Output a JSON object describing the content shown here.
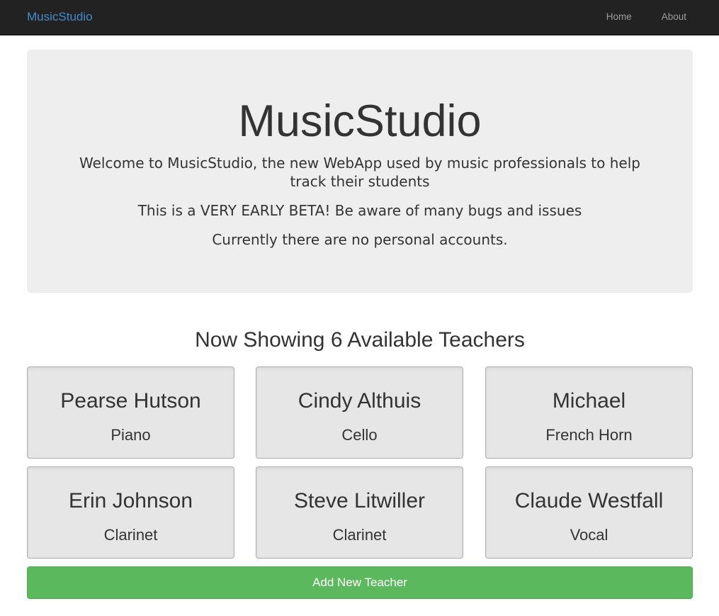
{
  "navbar": {
    "brand": "MusicStudio",
    "links": [
      {
        "label": "Home"
      },
      {
        "label": "About"
      }
    ],
    "colors": {
      "background": "#222222",
      "brand": "#428bca",
      "link": "#9d9d9d"
    }
  },
  "jumbotron": {
    "title": "MusicStudio",
    "lines": [
      "Welcome to MusicStudio, the new WebApp used by music professionals to help track their students",
      "This is a VERY EARLY BETA! Be aware of many bugs and issues",
      "Currently there are no personal accounts."
    ],
    "background": "#eeeeee"
  },
  "teachers": {
    "heading": "Now Showing 6 Available Teachers",
    "items": [
      {
        "name": "Pearse Hutson",
        "instrument": "Piano"
      },
      {
        "name": "Cindy Althuis",
        "instrument": "Cello"
      },
      {
        "name": "Michael",
        "instrument": "French Horn"
      },
      {
        "name": "Erin Johnson",
        "instrument": "Clarinet"
      },
      {
        "name": "Steve Litwiller",
        "instrument": "Clarinet"
      },
      {
        "name": "Claude Westfall",
        "instrument": "Vocal"
      }
    ],
    "card_background": "#e6e6e6"
  },
  "actions": {
    "add_teacher_label": "Add New Teacher",
    "add_teacher_color": "#5cb85c"
  }
}
